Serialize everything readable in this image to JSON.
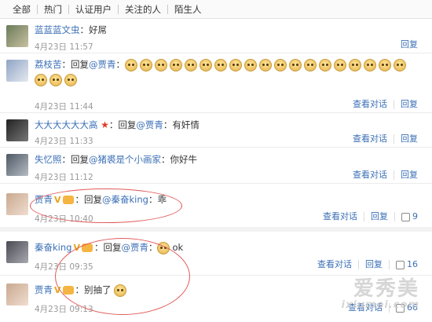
{
  "tabs": [
    "全部",
    "热门",
    "认证用户",
    "关注的人",
    "陌生人"
  ],
  "comments_top": [
    {
      "name": "蓝蓝蓝文虫",
      "text": "：好屌",
      "time": "4月23日 11:57",
      "actions": [
        "回复"
      ]
    },
    {
      "name": "荔枝苦",
      "prefix": "：回复",
      "at": "@贾青",
      "sep": "：",
      "emoji_count": 22,
      "time": "4月23日 11:44",
      "actions": [
        "查看对话",
        "回复"
      ]
    },
    {
      "name": "大大大大大大高",
      "prefix": "：回复",
      "at": "@贾青",
      "text": "：有奸情",
      "time": "4月23日 11:33",
      "actions": [
        "查看对话",
        "回复"
      ]
    },
    {
      "name": "失忆照",
      "prefix": "：回复",
      "at": "@猪裘是个小画家",
      "text": "：你好牛",
      "time": "4月23日 11:12",
      "actions": [
        "查看对话",
        "回复"
      ]
    },
    {
      "name": "贾青",
      "prefix": "：回复",
      "at": "@秦奋king",
      "text": "：乖",
      "time": "4月23日 10:40",
      "actions": [
        "查看对话",
        "回复"
      ],
      "likes": "9"
    }
  ],
  "comments_bottom": [
    {
      "name": "秦奋king",
      "prefix": "：回复",
      "at": "@贾青",
      "sep": "：",
      "text": "ok",
      "time": "4月23日 09:35",
      "actions": [
        "查看对话",
        "回复"
      ],
      "likes": "16"
    },
    {
      "name": "贾青",
      "text": "：别抽了",
      "time": "4月23日 09:13",
      "actions": [
        "查看对话"
      ],
      "likes": "66"
    }
  ],
  "watermark": {
    "line1": "爱秀美",
    "line2": "ixiumei.com"
  },
  "colors": {
    "link": "#3b6fb6",
    "time": "#999999",
    "annotation": "#e05a5a"
  }
}
